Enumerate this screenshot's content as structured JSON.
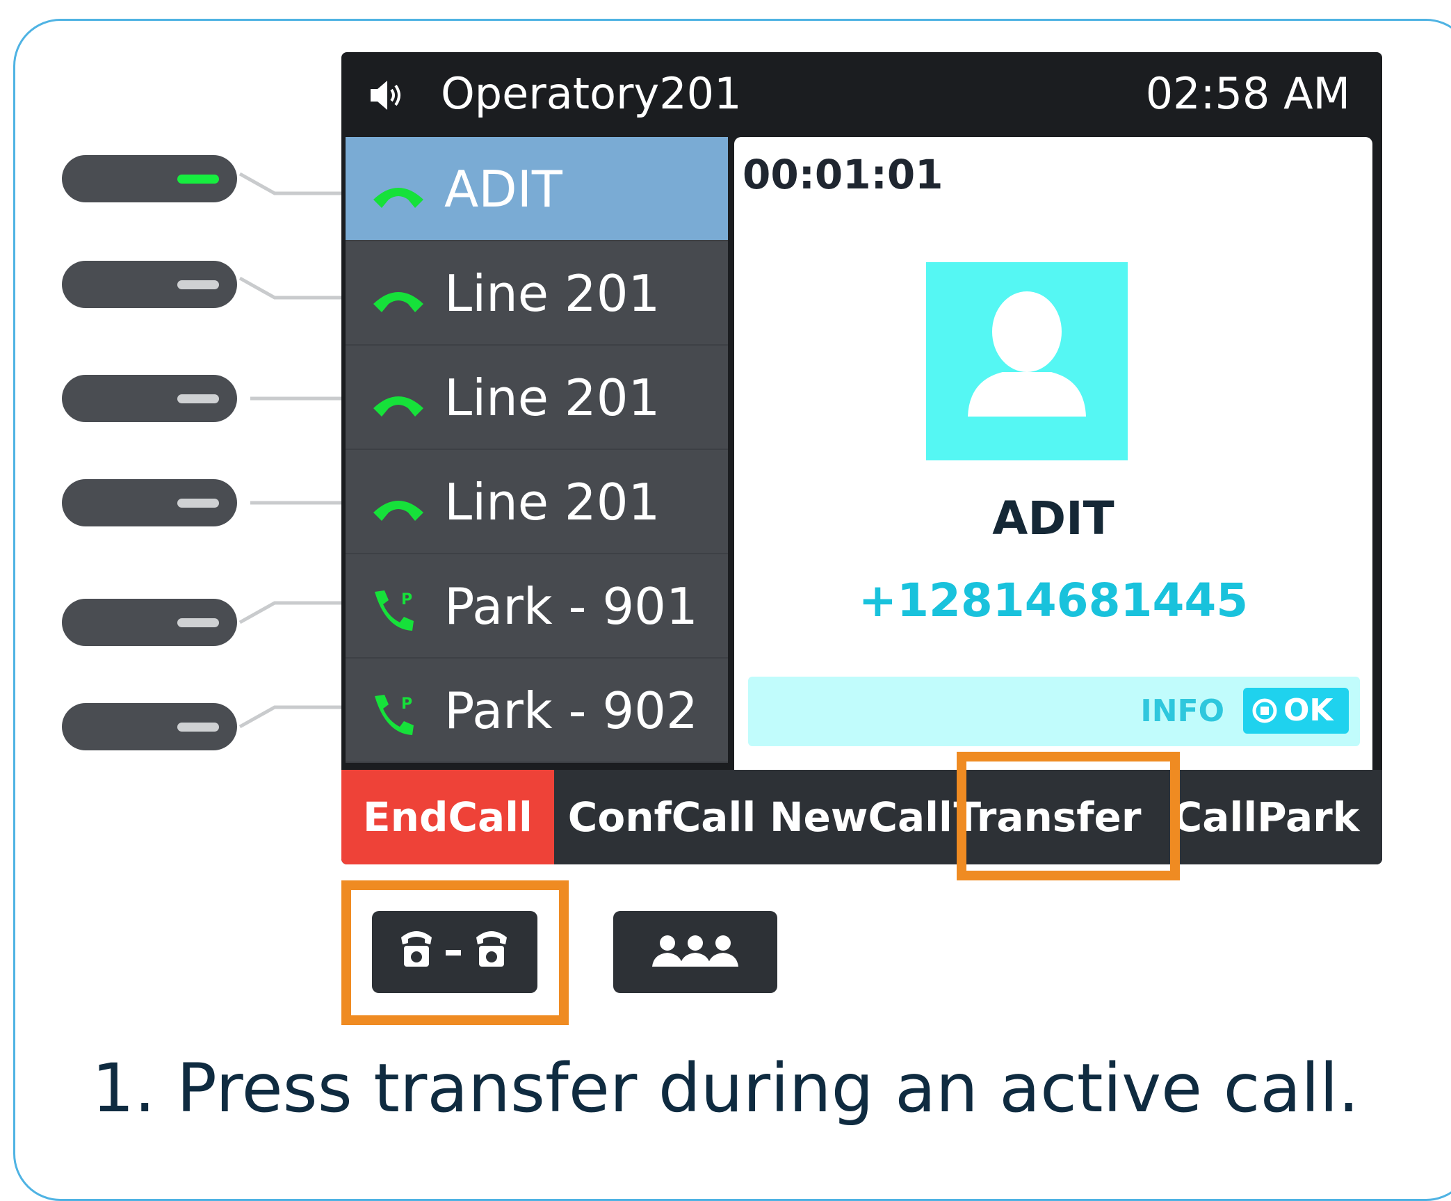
{
  "status_bar": {
    "account": "Operatory201",
    "time": "02:58 AM",
    "speaker_icon": "speaker-icon"
  },
  "lines": [
    {
      "label": "ADIT",
      "icon": "handset-icon",
      "active": true
    },
    {
      "label": "Line 201",
      "icon": "handset-icon",
      "active": false
    },
    {
      "label": "Line 201",
      "icon": "handset-icon",
      "active": false
    },
    {
      "label": "Line 201",
      "icon": "handset-icon",
      "active": false
    },
    {
      "label": "Park - 901",
      "icon": "park-phone-icon",
      "active": false
    },
    {
      "label": "Park - 902",
      "icon": "park-phone-icon",
      "active": false
    }
  ],
  "call_detail": {
    "timer": "00:01:01",
    "avatar_icon": "person-avatar-icon",
    "contact_name": "ADIT",
    "contact_number": "+12814681445",
    "info_label": "INFO",
    "ok_label": "OK"
  },
  "softkeys": [
    {
      "label": "EndCall"
    },
    {
      "label": "ConfCall"
    },
    {
      "label": "NewCall"
    },
    {
      "label": "Transfer"
    },
    {
      "label": "CallPark"
    }
  ],
  "hardware_keys": [
    {
      "icon": "transfer-key-icon"
    },
    {
      "icon": "conference-key-icon"
    }
  ],
  "colors": {
    "highlight": "#ef8b22",
    "end_call": "#ee4238",
    "active_line": "#7aabd4",
    "led_active": "#16ed3f",
    "accent": "#19c2dc",
    "frame": "#4fb3e3"
  },
  "caption": "1. Press transfer during an active call."
}
